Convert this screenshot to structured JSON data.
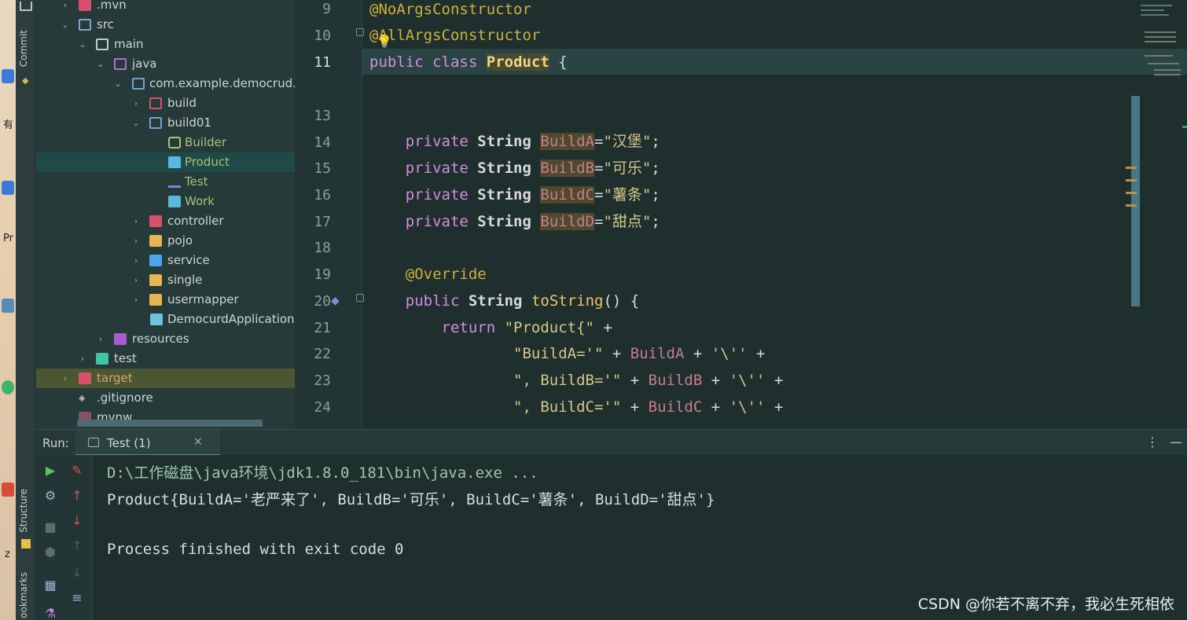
{
  "sidebar_tabs": {
    "commit": "Commit",
    "structure": "Structure",
    "bookmarks": "ookmarks"
  },
  "desktop_fragments": {
    "a": "有",
    "b": "Pr",
    "c": "z"
  },
  "project_tree": {
    "items": [
      {
        "label": ".mvn",
        "depth": 0,
        "arrow": "›",
        "icon": "folder-pink"
      },
      {
        "label": "src",
        "depth": 0,
        "arrow": "⌄",
        "icon": "folder-src"
      },
      {
        "label": "main",
        "depth": 1,
        "arrow": "⌄",
        "icon": "folder"
      },
      {
        "label": "java",
        "depth": 2,
        "arrow": "⌄",
        "icon": "folder-java"
      },
      {
        "label": "com.example.democrud.democurd",
        "depth": 3,
        "arrow": "⌄",
        "icon": "package"
      },
      {
        "label": "build",
        "depth": 4,
        "arrow": "›",
        "icon": "package-pink"
      },
      {
        "label": "build01",
        "depth": 4,
        "arrow": "⌄",
        "icon": "package"
      },
      {
        "label": "Builder",
        "depth": 5,
        "arrow": "",
        "icon": "interface-icon"
      },
      {
        "label": "Product",
        "depth": 5,
        "arrow": "",
        "icon": "class-icon"
      },
      {
        "label": "Test",
        "depth": 5,
        "arrow": "",
        "icon": "test-icon"
      },
      {
        "label": "Work",
        "depth": 5,
        "arrow": "",
        "icon": "class-icon"
      },
      {
        "label": "controller",
        "depth": 4,
        "arrow": "›",
        "icon": "folder-controller"
      },
      {
        "label": "pojo",
        "depth": 4,
        "arrow": "›",
        "icon": "folder-yellow"
      },
      {
        "label": "service",
        "depth": 4,
        "arrow": "›",
        "icon": "folder-service"
      },
      {
        "label": "single",
        "depth": 4,
        "arrow": "›",
        "icon": "folder-yellow"
      },
      {
        "label": "usermapper",
        "depth": 4,
        "arrow": "›",
        "icon": "folder-yellow"
      },
      {
        "label": "DemocurdApplication",
        "depth": 4,
        "arrow": "",
        "icon": "springboot-icon"
      },
      {
        "label": "resources",
        "depth": 2,
        "arrow": "›",
        "icon": "folder-resources"
      },
      {
        "label": "test",
        "depth": 1,
        "arrow": "›",
        "icon": "folder-test"
      },
      {
        "label": "target",
        "depth": 0,
        "arrow": "›",
        "icon": "folder-target"
      },
      {
        "label": ".gitignore",
        "depth": 0,
        "arrow": "",
        "icon": "git-icon"
      },
      {
        "label": "mvnw",
        "depth": 0,
        "arrow": "",
        "icon": "file-icon"
      }
    ],
    "selected": "Product",
    "highlighted": "target"
  },
  "editor": {
    "line_numbers": [
      "9",
      "10",
      "11",
      "",
      "13",
      "14",
      "15",
      "16",
      "17",
      "18",
      "19",
      "20",
      "21",
      "22",
      "23",
      "24"
    ],
    "current_line": "11",
    "lines": {
      "l9": "@NoArgsConstructor",
      "l10": "@AllArgsConstructor",
      "l11_kw1": "public",
      "l11_kw2": "class",
      "l11_name": "Product",
      "l11_rest": " {",
      "priv": "private",
      "str": "String",
      "fA": "BuildA",
      "vA": "\"汉堡\"",
      "fB": "BuildB",
      "vB": "\"可乐\"",
      "fC": "BuildC",
      "vC": "\"薯条\"",
      "fD": "BuildD",
      "vD": "\"甜点\"",
      "l19": "@Override",
      "l20_kw": "public",
      "l20_type": "String",
      "l20_fn": "toString",
      "l20_rest": "() {",
      "l21_kw": "return",
      "l21_str": "\"Product{\"",
      "l21_rest": " +",
      "l22_str": "\"BuildA='\"",
      "l22_field": "BuildA",
      "l22_end": "'\\''",
      "l23_str": "\", BuildB='\"",
      "l23_field": "BuildB",
      "l24_str": "\", BuildC='\"",
      "l24_field": "BuildC",
      "plus": " + ",
      "plus_end": " +"
    }
  },
  "run_panel": {
    "label": "Run:",
    "tab_label": "Test (1)",
    "close": "×",
    "menu": "⋮",
    "minimize": "—",
    "console": [
      "D:\\工作磁盘\\java环境\\jdk1.8.0_181\\bin\\java.exe ...",
      "Product{BuildA='老严来了', BuildB='可乐', BuildC='薯条', BuildD='甜点'}",
      "",
      "Process finished with exit code 0"
    ]
  },
  "watermark": "CSDN @你若不离不弃，我必生死相依",
  "colors": {
    "background": "#1e2f2e",
    "keyword": "#d58de0",
    "annotation": "#cdb13e",
    "field": "#c97b8e",
    "string": "#d5c689",
    "console_path": "#9fc7a9"
  }
}
